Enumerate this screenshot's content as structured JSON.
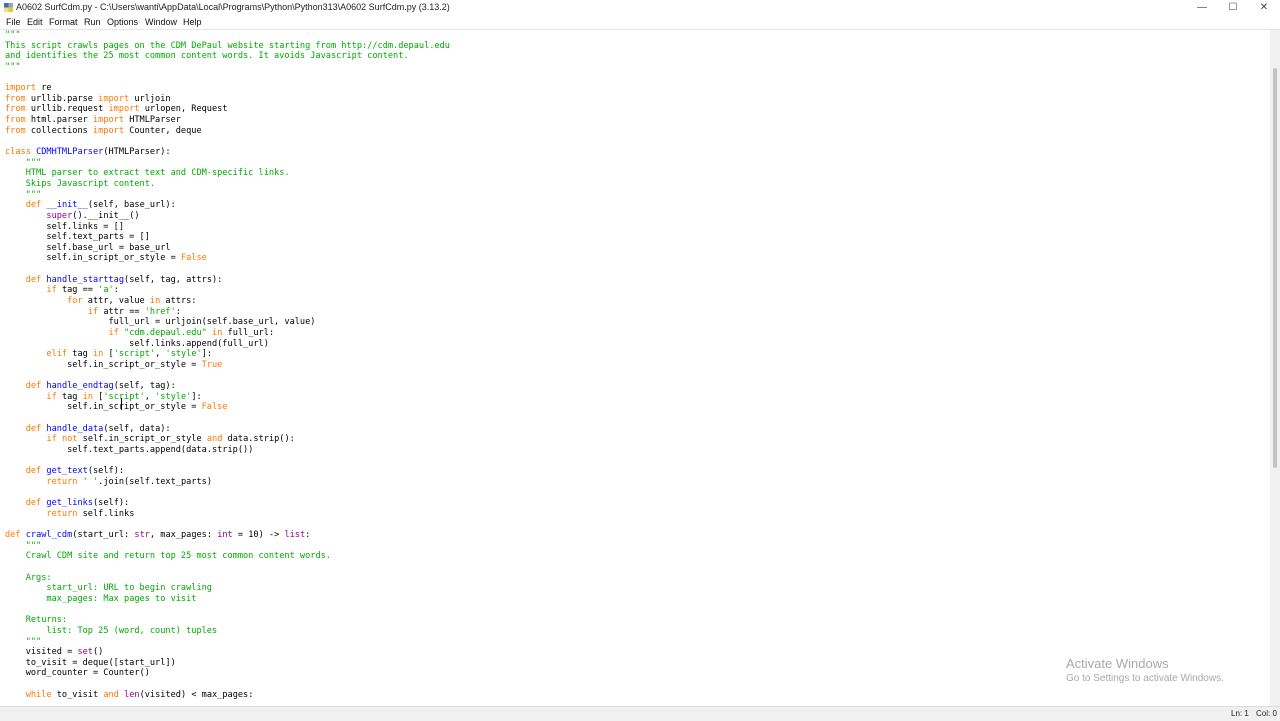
{
  "window": {
    "title": "A0602 SurfCdm.py - C:\\Users\\wanti\\AppData\\Local\\Programs\\Python\\Python313\\A0602 SurfCdm.py (3.13.2)",
    "controls": {
      "minimize": "—",
      "maximize": "☐",
      "close": "✕"
    }
  },
  "menu": {
    "items": [
      "File",
      "Edit",
      "Format",
      "Run",
      "Options",
      "Window",
      "Help"
    ]
  },
  "colors": {
    "keyword": "#ff7700",
    "string": "#00aa00",
    "definition": "#0000ff",
    "builtin": "#900090"
  },
  "code": {
    "lines": [
      [
        [
          "s",
          "\"\"\""
        ]
      ],
      [
        [
          "s",
          "This script crawls pages on the CDM DePaul website starting from http://cdm.depaul.edu"
        ]
      ],
      [
        [
          "s",
          "and identifies the 25 most common content words. It avoids Javascript content."
        ]
      ],
      [
        [
          "s",
          "\"\"\""
        ]
      ],
      [],
      [
        [
          "k",
          "import"
        ],
        [
          "t",
          " re"
        ]
      ],
      [
        [
          "k",
          "from"
        ],
        [
          "t",
          " urllib.parse "
        ],
        [
          "k",
          "import"
        ],
        [
          "t",
          " urljoin"
        ]
      ],
      [
        [
          "k",
          "from"
        ],
        [
          "t",
          " urllib.request "
        ],
        [
          "k",
          "import"
        ],
        [
          "t",
          " urlopen, Request"
        ]
      ],
      [
        [
          "k",
          "from"
        ],
        [
          "t",
          " html.parser "
        ],
        [
          "k",
          "import"
        ],
        [
          "t",
          " HTMLParser"
        ]
      ],
      [
        [
          "k",
          "from"
        ],
        [
          "t",
          " collections "
        ],
        [
          "k",
          "import"
        ],
        [
          "t",
          " Counter, deque"
        ]
      ],
      [],
      [
        [
          "k",
          "class"
        ],
        [
          "t",
          " "
        ],
        [
          "d",
          "CDMHTMLParser"
        ],
        [
          "t",
          "(HTMLParser):"
        ]
      ],
      [
        [
          "t",
          "    "
        ],
        [
          "s",
          "\"\"\""
        ]
      ],
      [
        [
          "t",
          "    "
        ],
        [
          "s",
          "HTML parser to extract text and CDM-specific links."
        ]
      ],
      [
        [
          "t",
          "    "
        ],
        [
          "s",
          "Skips Javascript content."
        ]
      ],
      [
        [
          "t",
          "    "
        ],
        [
          "s",
          "\"\"\""
        ]
      ],
      [
        [
          "t",
          "    "
        ],
        [
          "k",
          "def"
        ],
        [
          "t",
          " "
        ],
        [
          "d",
          "__init__"
        ],
        [
          "t",
          "(self, base_url):"
        ]
      ],
      [
        [
          "t",
          "        "
        ],
        [
          "b",
          "super"
        ],
        [
          "t",
          "().__init__()"
        ]
      ],
      [
        [
          "t",
          "        self.links = []"
        ]
      ],
      [
        [
          "t",
          "        self.text_parts = []"
        ]
      ],
      [
        [
          "t",
          "        self.base_url = base_url"
        ]
      ],
      [
        [
          "t",
          "        self.in_script_or_style = "
        ],
        [
          "k",
          "False"
        ]
      ],
      [],
      [
        [
          "t",
          "    "
        ],
        [
          "k",
          "def"
        ],
        [
          "t",
          " "
        ],
        [
          "d",
          "handle_starttag"
        ],
        [
          "t",
          "(self, tag, attrs):"
        ]
      ],
      [
        [
          "t",
          "        "
        ],
        [
          "k",
          "if"
        ],
        [
          "t",
          " tag == "
        ],
        [
          "s",
          "'a'"
        ],
        [
          "t",
          ":"
        ]
      ],
      [
        [
          "t",
          "            "
        ],
        [
          "k",
          "for"
        ],
        [
          "t",
          " attr, value "
        ],
        [
          "k",
          "in"
        ],
        [
          "t",
          " attrs:"
        ]
      ],
      [
        [
          "t",
          "                "
        ],
        [
          "k",
          "if"
        ],
        [
          "t",
          " attr == "
        ],
        [
          "s",
          "'href'"
        ],
        [
          "t",
          ":"
        ]
      ],
      [
        [
          "t",
          "                    full_url = urljoin(self.base_url, value)"
        ]
      ],
      [
        [
          "t",
          "                    "
        ],
        [
          "k",
          "if"
        ],
        [
          "t",
          " "
        ],
        [
          "s",
          "\"cdm.depaul.edu\""
        ],
        [
          "t",
          " "
        ],
        [
          "k",
          "in"
        ],
        [
          "t",
          " full_url:"
        ]
      ],
      [
        [
          "t",
          "                        self.links.append(full_url)"
        ]
      ],
      [
        [
          "t",
          "        "
        ],
        [
          "k",
          "elif"
        ],
        [
          "t",
          " tag "
        ],
        [
          "k",
          "in"
        ],
        [
          "t",
          " ["
        ],
        [
          "s",
          "'script'"
        ],
        [
          "t",
          ", "
        ],
        [
          "s",
          "'style'"
        ],
        [
          "t",
          "]:"
        ]
      ],
      [
        [
          "t",
          "            self.in_script_or_style = "
        ],
        [
          "k",
          "True"
        ]
      ],
      [],
      [
        [
          "t",
          "    "
        ],
        [
          "k",
          "def"
        ],
        [
          "t",
          " "
        ],
        [
          "d",
          "handle_endtag"
        ],
        [
          "t",
          "(self, tag):"
        ]
      ],
      [
        [
          "t",
          "        "
        ],
        [
          "k",
          "if"
        ],
        [
          "t",
          " tag "
        ],
        [
          "k",
          "in"
        ],
        [
          "t",
          " ["
        ],
        [
          "s",
          "'script'"
        ],
        [
          "t",
          ", "
        ],
        [
          "s",
          "'style'"
        ],
        [
          "t",
          "]:"
        ]
      ],
      [
        [
          "t",
          "            self.in_script_or_style = "
        ],
        [
          "k",
          "False"
        ]
      ],
      [],
      [
        [
          "t",
          "    "
        ],
        [
          "k",
          "def"
        ],
        [
          "t",
          " "
        ],
        [
          "d",
          "handle_data"
        ],
        [
          "t",
          "(self, data):"
        ]
      ],
      [
        [
          "t",
          "        "
        ],
        [
          "k",
          "if"
        ],
        [
          "t",
          " "
        ],
        [
          "k",
          "not"
        ],
        [
          "t",
          " self.in_script_or_style "
        ],
        [
          "k",
          "and"
        ],
        [
          "t",
          " data.strip():"
        ]
      ],
      [
        [
          "t",
          "            self.text_parts.append(data.strip())"
        ]
      ],
      [],
      [
        [
          "t",
          "    "
        ],
        [
          "k",
          "def"
        ],
        [
          "t",
          " "
        ],
        [
          "d",
          "get_text"
        ],
        [
          "t",
          "(self):"
        ]
      ],
      [
        [
          "t",
          "        "
        ],
        [
          "k",
          "return"
        ],
        [
          "t",
          " "
        ],
        [
          "s",
          "' '"
        ],
        [
          "t",
          ".join(self.text_parts)"
        ]
      ],
      [],
      [
        [
          "t",
          "    "
        ],
        [
          "k",
          "def"
        ],
        [
          "t",
          " "
        ],
        [
          "d",
          "get_links"
        ],
        [
          "t",
          "(self):"
        ]
      ],
      [
        [
          "t",
          "        "
        ],
        [
          "k",
          "return"
        ],
        [
          "t",
          " self.links"
        ]
      ],
      [],
      [
        [
          "k",
          "def"
        ],
        [
          "t",
          " "
        ],
        [
          "d",
          "crawl_cdm"
        ],
        [
          "t",
          "(start_url: "
        ],
        [
          "b",
          "str"
        ],
        [
          "t",
          ", max_pages: "
        ],
        [
          "b",
          "int"
        ],
        [
          "t",
          " = 10) -> "
        ],
        [
          "b",
          "list"
        ],
        [
          "t",
          ":"
        ]
      ],
      [
        [
          "t",
          "    "
        ],
        [
          "s",
          "\"\"\""
        ]
      ],
      [
        [
          "t",
          "    "
        ],
        [
          "s",
          "Crawl CDM site and return top 25 most common content words."
        ]
      ],
      [],
      [
        [
          "t",
          "    "
        ],
        [
          "s",
          "Args:"
        ]
      ],
      [
        [
          "t",
          "        "
        ],
        [
          "s",
          "start_url: URL to begin crawling"
        ]
      ],
      [
        [
          "t",
          "        "
        ],
        [
          "s",
          "max_pages: Max pages to visit"
        ]
      ],
      [],
      [
        [
          "t",
          "    "
        ],
        [
          "s",
          "Returns:"
        ]
      ],
      [
        [
          "t",
          "        "
        ],
        [
          "s",
          "list: Top 25 (word, count) tuples"
        ]
      ],
      [
        [
          "t",
          "    "
        ],
        [
          "s",
          "\"\"\""
        ]
      ],
      [
        [
          "t",
          "    visited = "
        ],
        [
          "b",
          "set"
        ],
        [
          "t",
          "()"
        ]
      ],
      [
        [
          "t",
          "    to_visit = deque([start_url])"
        ]
      ],
      [
        [
          "t",
          "    word_counter = Counter()"
        ]
      ],
      [],
      [
        [
          "t",
          "    "
        ],
        [
          "k",
          "while"
        ],
        [
          "t",
          " to_visit "
        ],
        [
          "k",
          "and"
        ],
        [
          "t",
          " "
        ],
        [
          "b",
          "len"
        ],
        [
          "t",
          "(visited) < max_pages:"
        ]
      ]
    ]
  },
  "watermark": {
    "line1": "Activate Windows",
    "line2": "Go to Settings to activate Windows."
  },
  "status": {
    "line": "Ln: 1",
    "col": "Col: 0"
  }
}
